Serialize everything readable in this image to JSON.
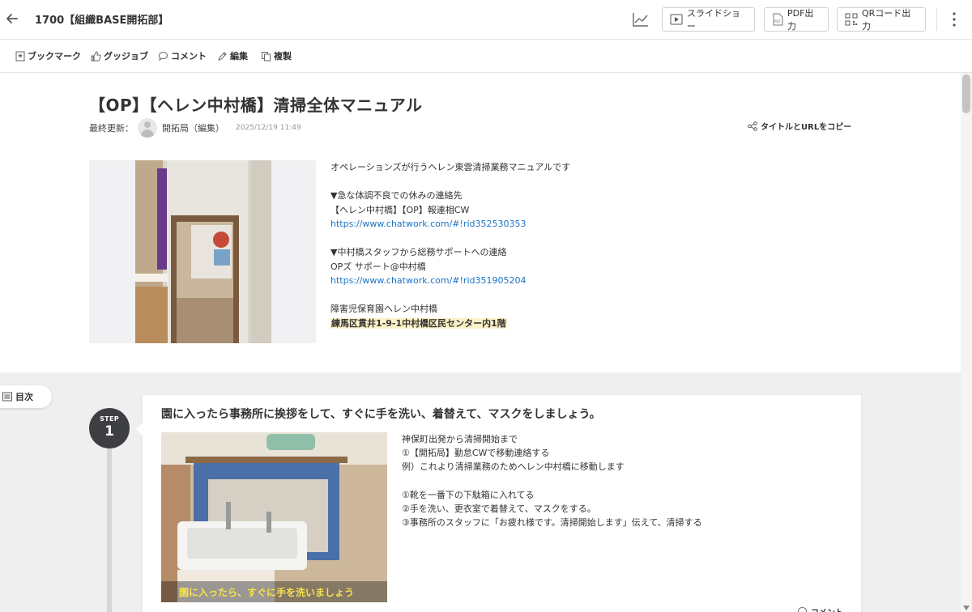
{
  "header": {
    "doc_title": "1700【組織BASE開拓部】",
    "buttons": {
      "slideshow": "スライドショー",
      "pdf": "PDF出力",
      "qr": "QRコード出力"
    }
  },
  "toolbar": {
    "bookmark": "ブックマーク",
    "goodjob": "グッジョブ",
    "comment": "コメント",
    "edit": "編集",
    "duplicate": "複製"
  },
  "manual": {
    "title": "【OP】【ヘレン中村橋】清掃全体マニュアル",
    "updated_label": "最終更新：",
    "author": "開拓局（編集）",
    "date": "2025/12/19 11:49",
    "copy_link": "タイトルとURLをコピー",
    "intro": {
      "line1": "オペレーションズが行うヘレン東雲清掃業務マニュアルです",
      "line2": "▼急な体調不良での休みの連絡先",
      "line3": "【ヘレン中村橋】【OP】報連相CW",
      "link1": "https://www.chatwork.com/#!rid352530353",
      "line4": "▼中村橋スタッフから総務サポートへの連絡",
      "line5": "OPズ サポート@中村橋",
      "link2": "https://www.chatwork.com/#!rid351905204",
      "line6": "障害児保育園ヘレン中村橋",
      "address": "練馬区貫井1-9-1中村橋区民センター内1階"
    }
  },
  "toc": {
    "label": "目次"
  },
  "step1": {
    "step_label": "STEP",
    "number": "1",
    "title": "園に入ったら事務所に挨拶をして、すぐに手を洗い、着替えて、マスクをしましょう。",
    "image_caption": "園に入ったら、すぐに手を洗いましょう",
    "text": {
      "line1": "神保町出発から清掃開始まで",
      "line2": "①【開拓局】勤怠CWで移動連絡する",
      "line3": "例）これより清掃業務のためヘレン中村橋に移動します",
      "line4": "①靴を一番下の下駄箱に入れてる",
      "line5": "②手を洗い、更衣室で着替えて、マスクをする。",
      "line6": "③事務所のスタッフに「お疲れ様です。清掃開始します」伝えて、清掃する"
    },
    "comment": "コメント"
  }
}
